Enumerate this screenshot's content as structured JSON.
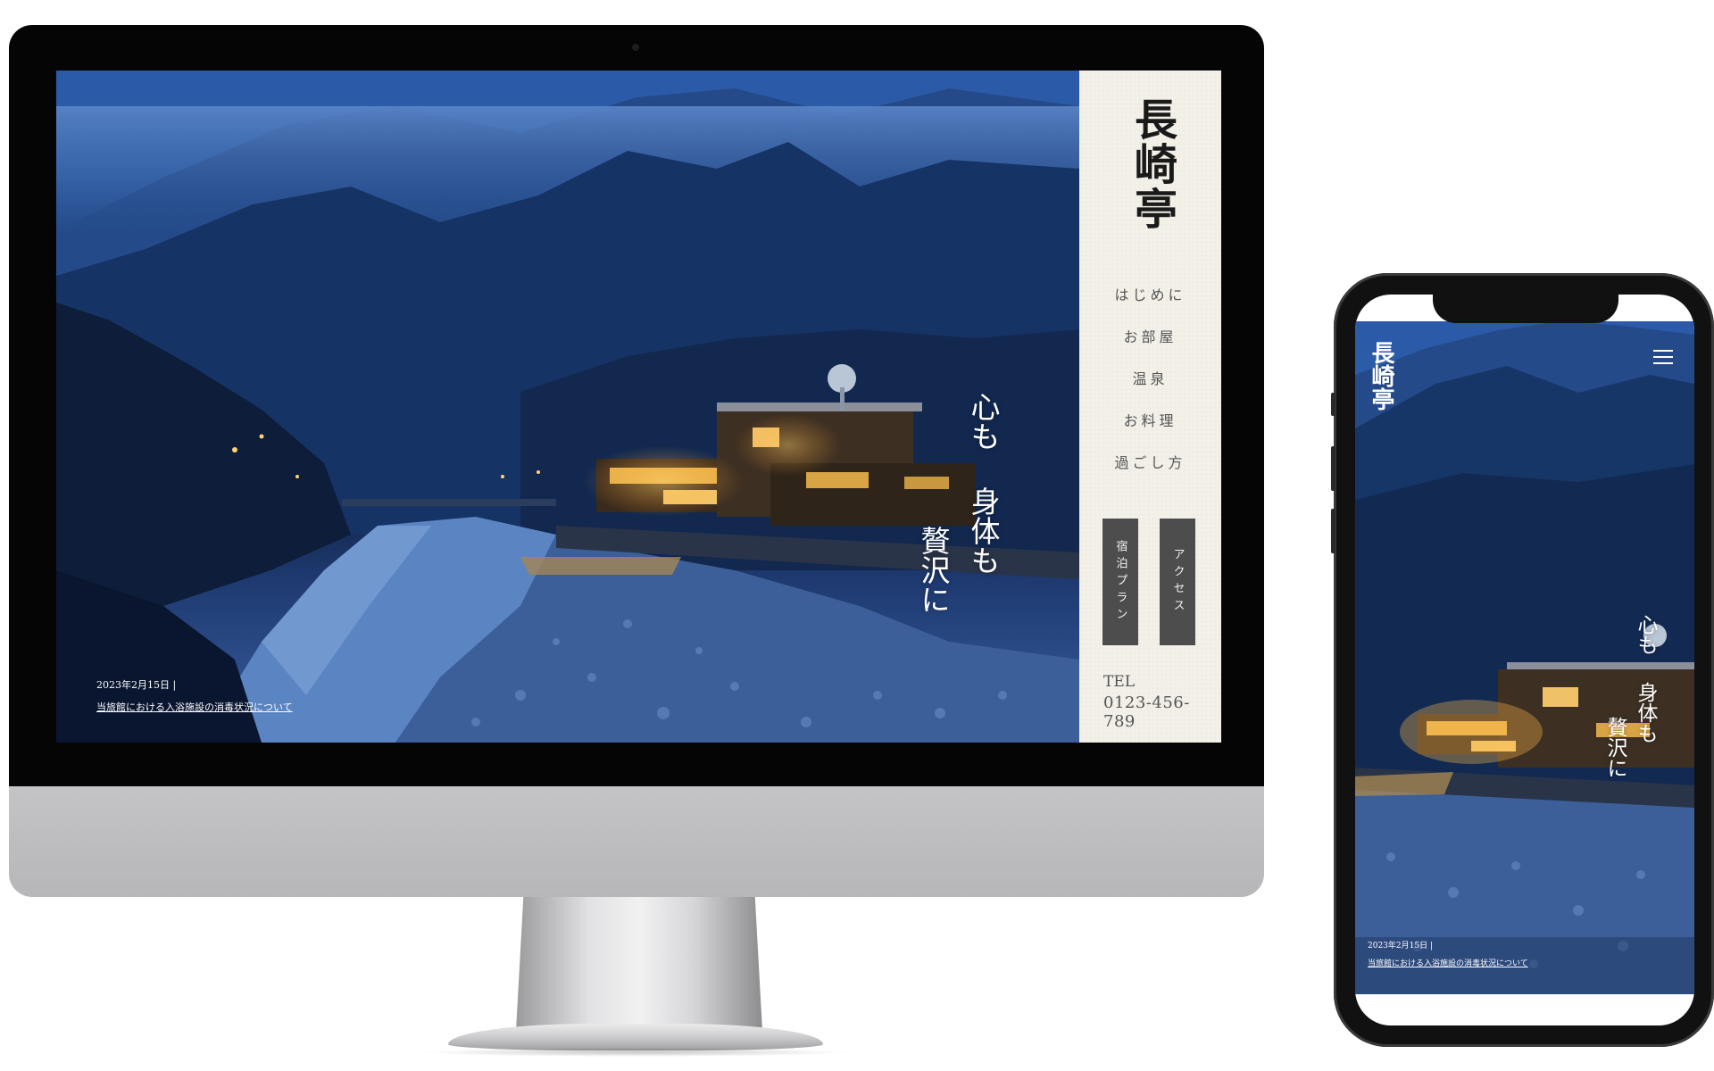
{
  "site": {
    "logo": "長崎亭",
    "nav": [
      "はじめに",
      "お部屋",
      "温泉",
      "お料理",
      "過ごし方"
    ],
    "buttons": {
      "plan": "宿泊プラン",
      "access": "アクセス"
    },
    "tel_label": "TEL",
    "tel_number": "0123-456-789",
    "catchcopy": [
      "心も",
      "身体も",
      "贅沢に"
    ],
    "news": {
      "date": "2023年2月15日 |",
      "title": "当旅館における入浴施設の消毒状況について"
    }
  },
  "icons": {
    "menu": "hamburger-menu-icon"
  },
  "colors": {
    "sidebar_bg": "#f3f0e8",
    "button_bg": "#4d4d4d",
    "hero_blue": "#1f3f78",
    "device_black": "#050505",
    "monitor_silver": "#c4c4c6"
  }
}
